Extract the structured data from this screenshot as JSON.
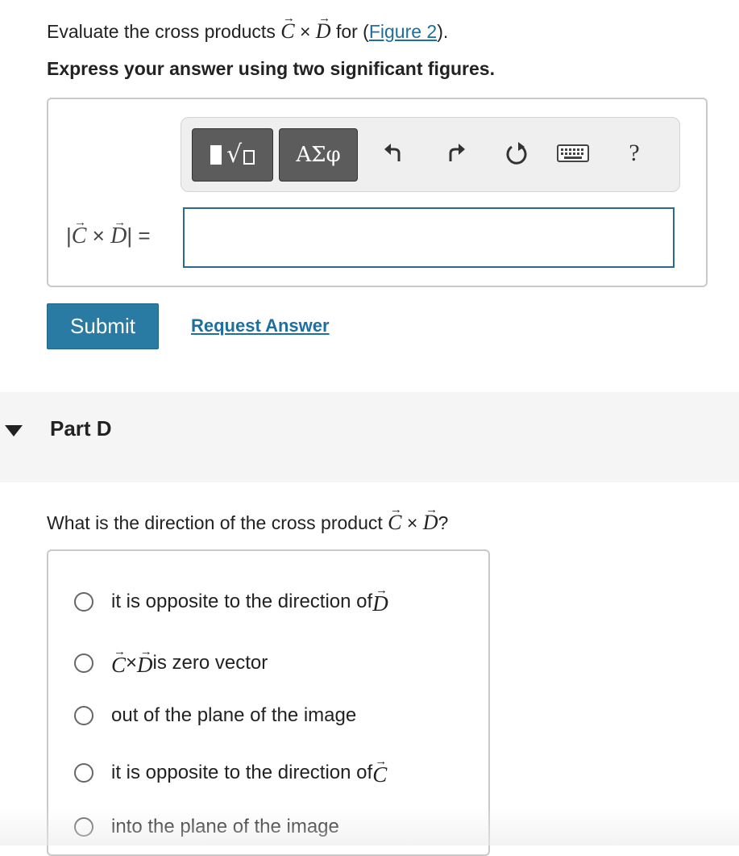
{
  "partC": {
    "question_prefix": "Evaluate the cross products ",
    "question_symbol_c": "C",
    "question_cross": " × ",
    "question_symbol_d": "D",
    "question_for": " for (",
    "figure_link": "Figure 2",
    "question_suffix": ").",
    "instruction": "Express your answer using two significant figures.",
    "toolbar": {
      "templates_label": "templates",
      "symbols_label": "ΑΣφ",
      "undo_label": "undo",
      "redo_label": "redo",
      "reset_label": "reset",
      "keyboard_label": "keyboard",
      "help_label": "?"
    },
    "lhs": {
      "bar_open": "|",
      "c": "C",
      "cross": " × ",
      "d": "D",
      "bar_close": "|",
      "equals": " ="
    },
    "answer_value": "",
    "submit_label": "Submit",
    "request_answer_label": "Request Answer"
  },
  "partD": {
    "title": "Part D",
    "question_prefix": "What is the direction of the cross product ",
    "c": "C",
    "cross": " × ",
    "d": "D",
    "question_suffix": "?",
    "choices": [
      {
        "text": "it is opposite to the direction of ",
        "symbol": "D"
      },
      {
        "symbol_c": "C",
        "cross": " × ",
        "symbol_d": "D",
        "text": " is zero vector"
      },
      {
        "text": "out of the plane of the image"
      },
      {
        "text": "it is opposite to the direction of ",
        "symbol": "C"
      },
      {
        "text": "into the plane of the image"
      }
    ]
  },
  "colors": {
    "accent": "#2a7ba3",
    "link": "#1e6e9e",
    "input_border": "#2b6a8f",
    "toolbar_button": "#5c5c5c"
  }
}
